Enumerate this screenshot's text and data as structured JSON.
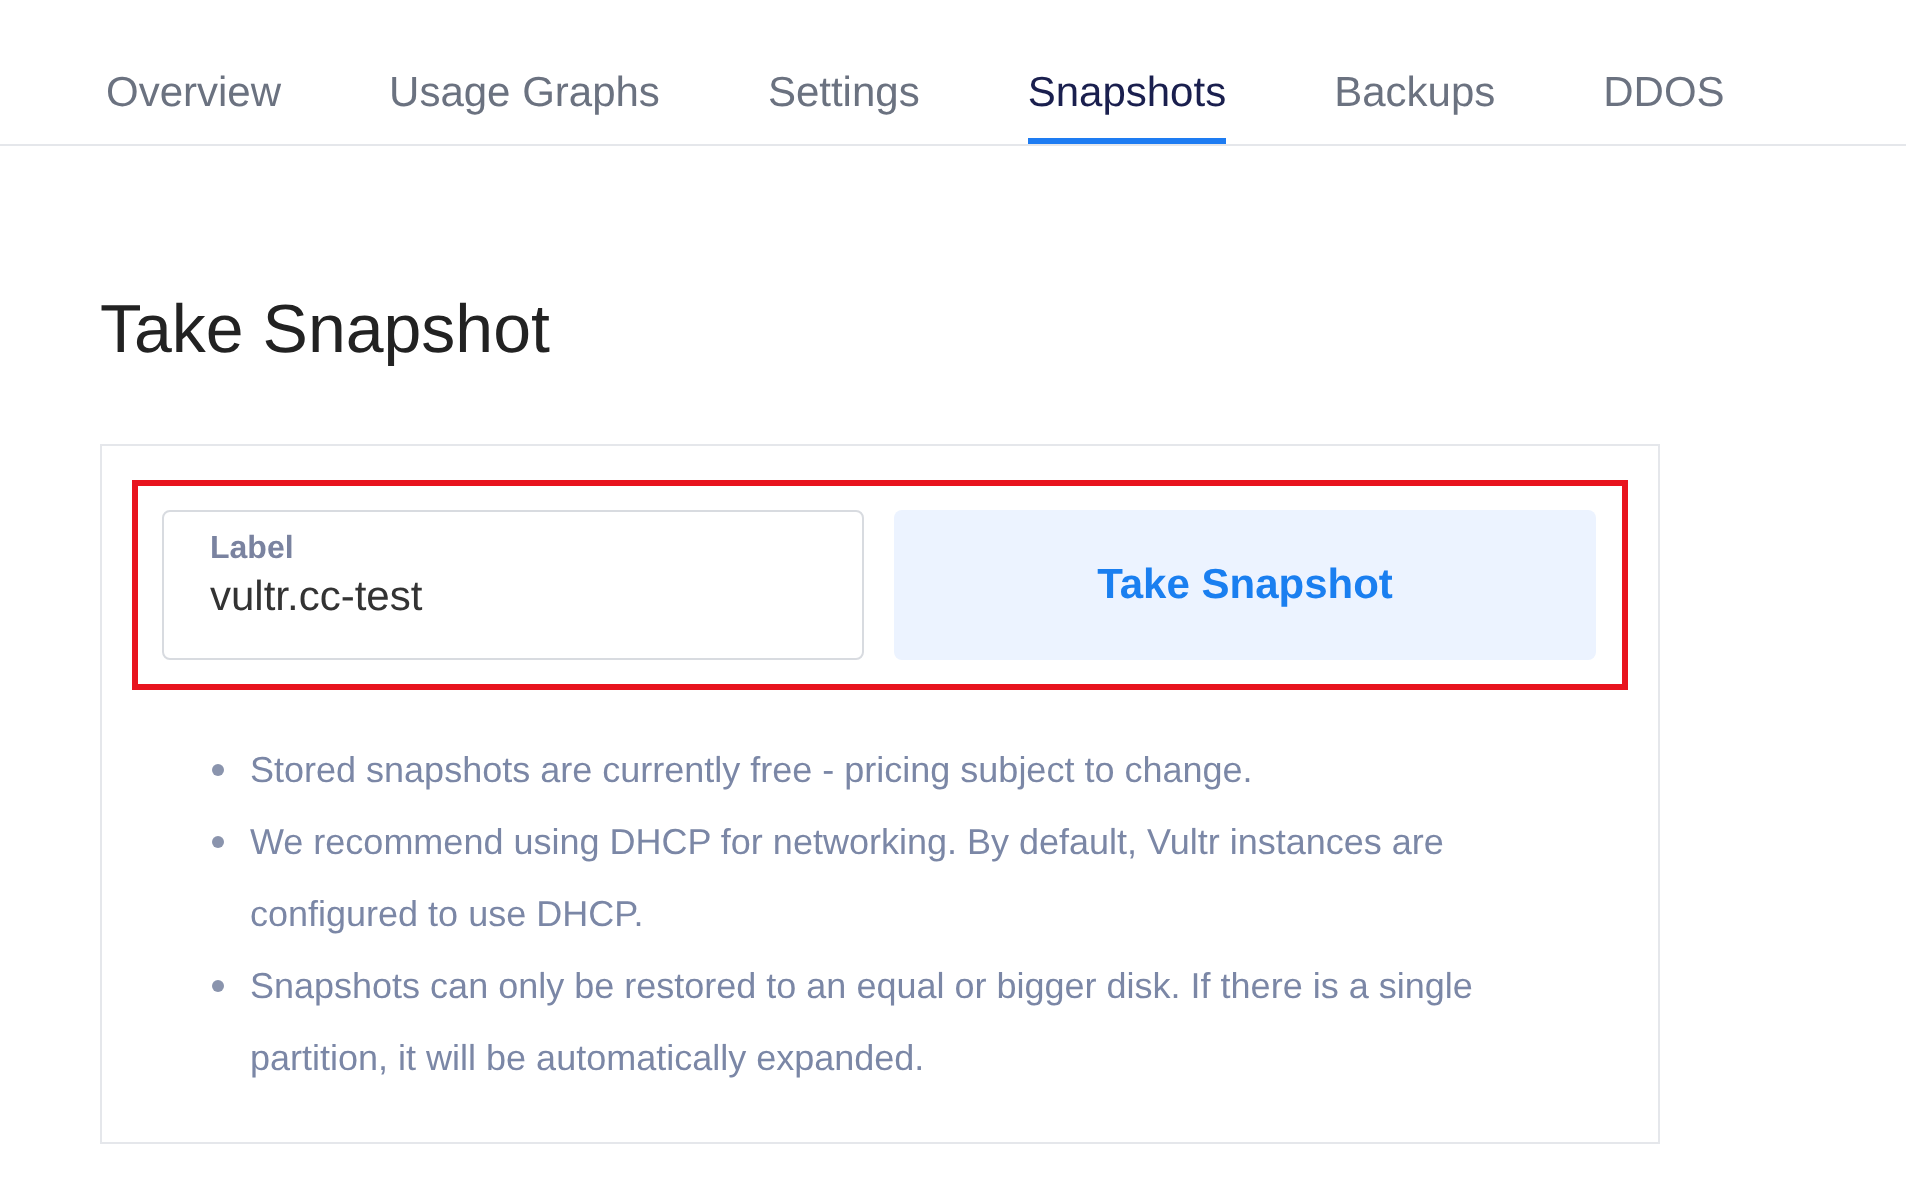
{
  "tabs": [
    {
      "label": "Overview",
      "selected": false
    },
    {
      "label": "Usage Graphs",
      "selected": false
    },
    {
      "label": "Settings",
      "selected": false
    },
    {
      "label": "Snapshots",
      "selected": true
    },
    {
      "label": "Backups",
      "selected": false
    },
    {
      "label": "DDOS",
      "selected": false
    }
  ],
  "heading": "Take Snapshot",
  "form": {
    "highlighted": true,
    "label_field": {
      "label": "Label",
      "value": "vultr.cc-test"
    },
    "button": "Take Snapshot"
  },
  "notes": [
    "Stored snapshots are currently free - pricing subject to change.",
    "We recommend using DHCP for networking. By default, Vultr instances are configured to use DHCP.",
    "Snapshots can only be restored to an equal or bigger disk. If there is a single partition, it will be automatically expanded."
  ]
}
